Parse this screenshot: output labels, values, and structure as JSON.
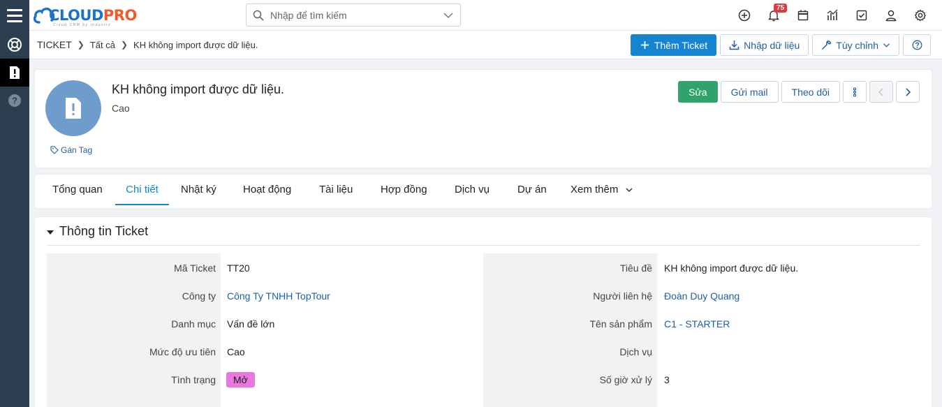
{
  "header": {
    "logo_part1": "CLOUD",
    "logo_part2": "PRO",
    "logo_tagline": "Cloud CRM by Industry",
    "search_placeholder": "Nhập để tìm kiếm",
    "notification_count": "75"
  },
  "breadcrumb": {
    "module": "TICKET",
    "level1": "Tất cả",
    "current": "KH không import được dữ liệu."
  },
  "toolbar": {
    "add_label": "Thêm Ticket",
    "import_label": "Nhập dữ liệu",
    "customize_label": "Tùy chỉnh"
  },
  "record": {
    "title": "KH không import được dữ liệu.",
    "subtitle": "Cao",
    "tag_label": "Gán Tag",
    "edit_label": "Sửa",
    "send_mail_label": "Gửi mail",
    "follow_label": "Theo dõi"
  },
  "tabs": [
    {
      "label": "Tổng quan"
    },
    {
      "label": "Chi tiết"
    },
    {
      "label": "Nhật ký"
    },
    {
      "label": "Hoạt động"
    },
    {
      "label": "Tài liệu"
    },
    {
      "label": "Hợp đồng"
    },
    {
      "label": "Dịch vụ"
    },
    {
      "label": "Dự án"
    },
    {
      "label": "Xem thêm"
    }
  ],
  "active_tab": "Chi tiết",
  "section": {
    "title": "Thông tin Ticket",
    "left_fields": [
      {
        "label": "Mã Ticket",
        "value": "TT20"
      },
      {
        "label": "Công ty",
        "value": "Công Ty TNHH TopTour"
      },
      {
        "label": "Danh mục",
        "value": "Vấn đề lớn"
      },
      {
        "label": "Mức độ ưu tiên",
        "value": "Cao"
      },
      {
        "label": "Tình trạng",
        "value": "Mở"
      }
    ],
    "right_fields": [
      {
        "label": "Tiêu đề",
        "value": "KH không import được dữ liệu."
      },
      {
        "label": "Người liên hệ",
        "value": "Đoàn Duy Quang"
      },
      {
        "label": "Tên sản phẩm",
        "value": "C1 - STARTER"
      },
      {
        "label": "Dịch vụ",
        "value": ""
      },
      {
        "label": "Số giờ xử lý",
        "value": "3"
      }
    ]
  },
  "colors": {
    "sidebar": "#2c3e50",
    "primary": "#1585d1",
    "edit_button": "#2fa36b",
    "status_pill": "#e877e0",
    "link": "#1f5fa3"
  }
}
